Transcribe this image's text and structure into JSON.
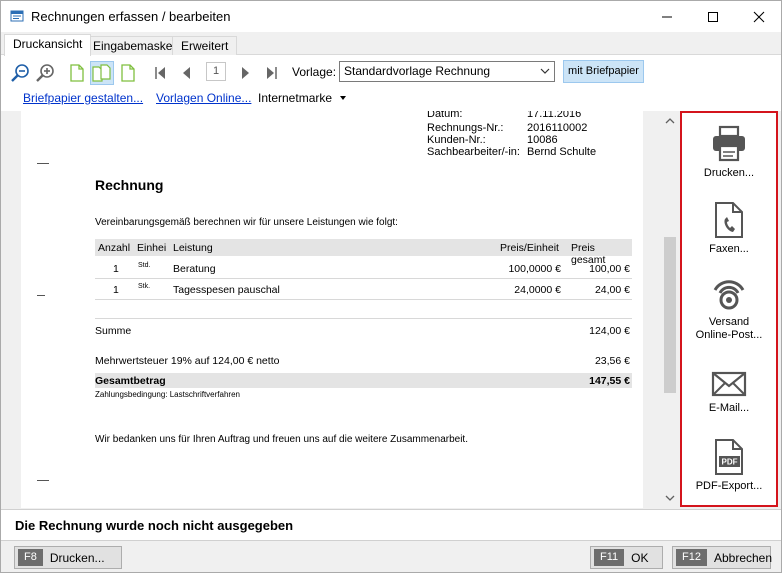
{
  "window": {
    "title": "Rechnungen erfassen / bearbeiten",
    "controls": {
      "minimize": "minimize-icon",
      "maximize": "maximize-icon",
      "close": "close-icon"
    }
  },
  "tabs": [
    {
      "label": "Druckansicht",
      "active": true
    },
    {
      "label": "Eingabemaske",
      "active": false
    },
    {
      "label": "Erweitert",
      "active": false
    }
  ],
  "toolbar": {
    "page_number": "1",
    "vorlage_label": "Vorlage:",
    "vorlage_value": "Standardvorlage Rechnung",
    "briefpapier_button": "mit Briefpapier",
    "links": {
      "briefpapier": "Briefpapier gestalten...",
      "vorlagen": "Vorlagen Online..."
    },
    "internetmarke": "Internetmarke"
  },
  "document": {
    "meta": [
      {
        "label": "Datum:",
        "value": "17.11.2016"
      },
      {
        "label": "Rechnungs-Nr.:",
        "value": "2016110002"
      },
      {
        "label": "Kunden-Nr.:",
        "value": "10086"
      },
      {
        "label": "Sachbearbeiter/-in:",
        "value": "Bernd Schulte"
      }
    ],
    "title": "Rechnung",
    "intro": "Vereinbarungsgemäß berechnen wir für unsere Leistungen wie folgt:",
    "columns": {
      "anzahl": "Anzahl",
      "einheit": "Einhei",
      "leistung": "Leistung",
      "preis_einheit": "Preis/Einheit",
      "preis_gesamt": "Preis gesamt"
    },
    "items": [
      {
        "anzahl": "1",
        "einheit": "Std.",
        "leistung": "Beratung",
        "preis_einheit": "100,0000 €",
        "preis_gesamt": "100,00 €"
      },
      {
        "anzahl": "1",
        "einheit": "Stk.",
        "leistung": "Tagesspesen pauschal",
        "preis_einheit": "24,0000 €",
        "preis_gesamt": "24,00 €"
      }
    ],
    "summe_label": "Summe",
    "summe_value": "124,00 €",
    "mwst_label": "Mehrwertsteuer 19% auf 124,00 € netto",
    "mwst_value": "23,56 €",
    "gesamt_label": "Gesamtbetrag",
    "gesamt_value": "147,55 €",
    "zahlung": "Zahlungsbedingung: Lastschriftverfahren",
    "danke": "Wir bedanken uns für Ihren Auftrag und freuen uns auf die weitere Zusammenarbeit."
  },
  "side_panel": {
    "drucken": "Drucken...",
    "faxen": "Faxen...",
    "versand_line1": "Versand",
    "versand_line2": "Online-Post...",
    "email": "E-Mail...",
    "pdf": "PDF-Export...",
    "pdf_icon_text": "PDF"
  },
  "status": {
    "message": "Die Rechnung wurde noch nicht ausgegeben"
  },
  "footer": {
    "drucken": {
      "key": "F8",
      "label": "Drucken..."
    },
    "ok": {
      "key": "F11",
      "label": "OK"
    },
    "abbrechen": {
      "key": "F12",
      "label": "Abbrechen"
    }
  },
  "colors": {
    "accent": "#d4141c",
    "toggle_bg": "#cce4f7",
    "link": "#0033cc"
  }
}
